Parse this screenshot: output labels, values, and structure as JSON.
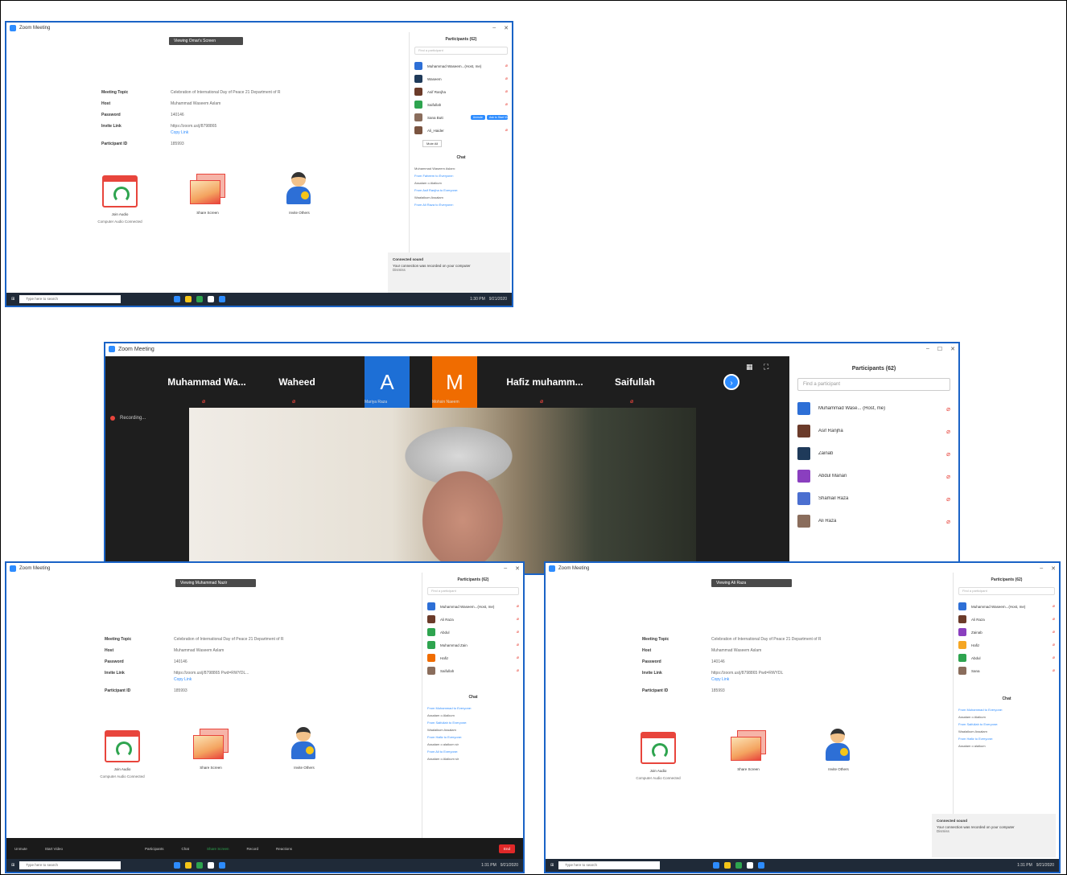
{
  "top_window": {
    "title": "Zoom Meeting",
    "banner": "Viewing Omar's Screen",
    "info": [
      {
        "k": "Meeting Topic",
        "v": "Celebration of International Day of Peace 21 Department of R"
      },
      {
        "k": "Host",
        "v": "Muhammad Waseem Aslam"
      },
      {
        "k": "Password",
        "v": "140146"
      },
      {
        "k": "Invite Link",
        "v": "https://zoom.us/j/8798865"
      },
      {
        "k": "Participant ID",
        "v": "185993"
      }
    ],
    "copy_link": "Copy Link",
    "tiles": [
      {
        "label": "Join Audio",
        "sub": "Computer Audio Connected"
      },
      {
        "label": "Share Screen",
        "sub": ""
      },
      {
        "label": "Invite Others",
        "sub": ""
      }
    ],
    "panel": {
      "header": "Participants (62)",
      "search": "Find a participant",
      "participants": [
        {
          "name": "Muhammad Waseem...(Host, me)",
          "color": "#2d6fd6",
          "initials": "MW"
        },
        {
          "name": "Waseem",
          "color": "#1f3a5a",
          "initials": "W"
        },
        {
          "name": "Asif Ranjha",
          "color": "#6b3b2a",
          "initials": ""
        },
        {
          "name": "Saifullah",
          "color": "#2ea44f",
          "initials": "S"
        },
        {
          "name": "Sana Butt",
          "color": "#8a6d5c",
          "initials": ""
        },
        {
          "name": "Ali_Haider",
          "color": "#7a5440",
          "initials": ""
        }
      ],
      "unmute": "Unmute",
      "ask": "Ask to Start Video",
      "mute_all": "Mute All",
      "chat_header": "Chat",
      "chat": [
        "Muhammad Waseem Aslam:",
        "From Faheem to Everyone:",
        "Assalam o Alaikum",
        "From Asif Ranjha to Everyone:",
        "Waalaikum Assalam",
        "From Ali Raza to Everyone:"
      ]
    },
    "toast": {
      "title": "Connected sound",
      "body": "Your connection was recorded on your computer",
      "link": "Dismiss"
    },
    "taskbar": {
      "search": "Type here to search",
      "time": "1:30 PM",
      "date": "9/21/2020"
    }
  },
  "video_window": {
    "title": "Zoom Meeting",
    "strip": [
      {
        "kind": "name",
        "label": "Muhammad Wa...",
        "sub": ""
      },
      {
        "kind": "name",
        "label": "Waheed",
        "sub": ""
      },
      {
        "kind": "A",
        "label": "A",
        "sub": "Mariya Raza"
      },
      {
        "kind": "M",
        "label": "M",
        "sub": "Mohsin Naeem"
      },
      {
        "kind": "name",
        "label": "Hafiz muhamm...",
        "sub": ""
      },
      {
        "kind": "name",
        "label": "Saifullah",
        "sub": ""
      }
    ],
    "recording": "Recording...",
    "panel": {
      "header": "Participants (62)",
      "search": "Find a participant",
      "participants": [
        {
          "name": "Muhammad Wase... (Host, me)",
          "color": "#2d6fd6",
          "initials": "MW"
        },
        {
          "name": "Asif Ranjha",
          "color": "#6b3b2a",
          "initials": ""
        },
        {
          "name": "Zainab",
          "color": "#1f3a5a",
          "initials": "Z"
        },
        {
          "name": "Abdul Manan",
          "color": "#8a3fbf",
          "initials": "AM"
        },
        {
          "name": "Shamail Raza",
          "color": "#4b6fd0",
          "initials": ""
        },
        {
          "name": "Ali Raza",
          "color": "#8a6d5c",
          "initials": ""
        }
      ]
    }
  },
  "left_window": {
    "title": "Zoom Meeting",
    "banner": "Viewing Muhammad Nazir",
    "info": [
      {
        "k": "Meeting Topic",
        "v": "Celebration of International Day of Peace 21 Department of R"
      },
      {
        "k": "Host",
        "v": "Muhammad Waseem Aslam"
      },
      {
        "k": "Password",
        "v": "140146"
      },
      {
        "k": "Invite Link",
        "v": "https://zoom.us/j/8798865 Pwd=RWYDL..."
      },
      {
        "k": "Participant ID",
        "v": "185993"
      }
    ],
    "copy_link": "Copy Link",
    "tiles": [
      {
        "label": "Join Audio",
        "sub": "Computer Audio Connected"
      },
      {
        "label": "Share Screen",
        "sub": ""
      },
      {
        "label": "Invite Others",
        "sub": ""
      }
    ],
    "panel": {
      "header": "Participants (62)",
      "search": "Find a participant",
      "participants": [
        {
          "name": "Muhammad Waseem...(Host, me)",
          "color": "#2d6fd6",
          "initials": "MW"
        },
        {
          "name": "Ali Raza",
          "color": "#6b3b2a",
          "initials": ""
        },
        {
          "name": "Abdul",
          "color": "#2ea44f",
          "initials": "A"
        },
        {
          "name": "Muhammad Zain",
          "color": "#2ea44f",
          "initials": "M"
        },
        {
          "name": "Hafiz",
          "color": "#f06c00",
          "initials": "H"
        },
        {
          "name": "Saifullah",
          "color": "#8a6d5c",
          "initials": ""
        }
      ],
      "chat_header": "Chat",
      "chat": [
        "From Muhammad to Everyone:",
        "Assalam o Alaikum",
        "From Saifullah to Everyone:",
        "Waalaikum Assalam",
        "From Hafiz to Everyone:",
        "Assalam o alaikum sir",
        "From Ali to Everyone:",
        "Assalam o Alaikum sir"
      ]
    },
    "meetbar": [
      "Unmute",
      "Start Video",
      "Participants",
      "Chat",
      "Share Screen",
      "Record",
      "Reactions"
    ],
    "end": "End",
    "taskbar": {
      "search": "Type here to search",
      "time": "1:31 PM",
      "date": "9/21/2020"
    }
  },
  "right_window": {
    "title": "Zoom Meeting",
    "banner": "Viewing Ali Raza",
    "info": [
      {
        "k": "Meeting Topic",
        "v": "Celebration of International Day of Peace 21 Department of R"
      },
      {
        "k": "Host",
        "v": "Muhammad Waseem Aslam"
      },
      {
        "k": "Password",
        "v": "140146"
      },
      {
        "k": "Invite Link",
        "v": "https://zoom.us/j/8798865 Pwd=RWYDL"
      },
      {
        "k": "Participant ID",
        "v": "185993"
      }
    ],
    "copy_link": "Copy Link",
    "tiles": [
      {
        "label": "Join Audio",
        "sub": "Computer Audio Connected"
      },
      {
        "label": "Share Screen",
        "sub": ""
      },
      {
        "label": "Invite Others",
        "sub": ""
      }
    ],
    "panel": {
      "header": "Participants (62)",
      "search": "Find a participant",
      "participants": [
        {
          "name": "Muhammad Waseem...(Host, me)",
          "color": "#2d6fd6",
          "initials": "MW"
        },
        {
          "name": "Ali Raza",
          "color": "#6b3b2a",
          "initials": ""
        },
        {
          "name": "Zainab",
          "color": "#8a3fbf",
          "initials": "Z"
        },
        {
          "name": "Hafiz",
          "color": "#f5a623",
          "initials": "H"
        },
        {
          "name": "Abdul",
          "color": "#2ea44f",
          "initials": "A"
        },
        {
          "name": "Sana",
          "color": "#8a6d5c",
          "initials": ""
        }
      ],
      "chat_header": "Chat",
      "chat": [
        "From Muhammad to Everyone:",
        "Assalam o Alaikum",
        "From Saifullah to Everyone:",
        "Waalaikum Assalam",
        "From Hafiz to Everyone:",
        "Assalam o alaikum"
      ]
    },
    "toast": {
      "title": "Connected sound",
      "body": "Your connection was recorded on your computer",
      "link": "Dismiss"
    },
    "taskbar": {
      "search": "Type here to search",
      "time": "1:31 PM",
      "date": "9/21/2020"
    }
  }
}
